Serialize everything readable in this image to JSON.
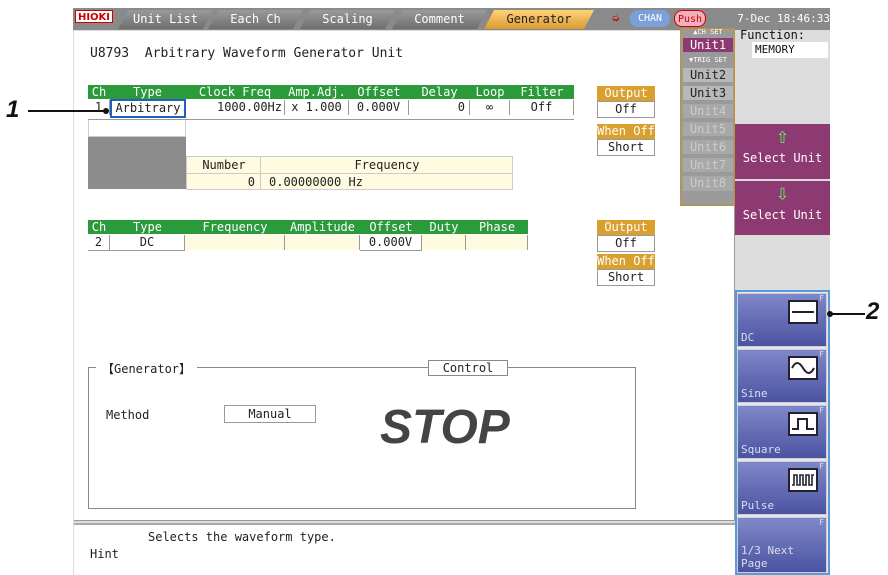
{
  "tabs": {
    "logo": "HIOKI",
    "items": [
      "Unit List",
      "Each Ch",
      "Scaling",
      "Comment",
      "Generator"
    ],
    "chan": "CHAN",
    "push": "Push",
    "datetime": "7-Dec 18:46:33"
  },
  "title": "U8793  Arbitrary Waveform Generator Unit",
  "ch1": {
    "headers": [
      "Ch",
      "Type",
      "Clock Freq",
      "Amp.Adj.",
      "Offset",
      "Delay",
      "Loop",
      "Filter"
    ],
    "ch": "1",
    "type": "Arbitrary",
    "clock": "1000.00Hz",
    "amp": "x 1.000",
    "offset": "0.000V",
    "delay": "0",
    "loop": "∞",
    "filter": "Off"
  },
  "ch1_output": {
    "h1": "Output",
    "v1": "Off",
    "h2": "When Off",
    "v2": "Short"
  },
  "ch1_sub": {
    "h_number": "Number",
    "h_freq": "Frequency",
    "number": "0",
    "freq": "0.00000000 Hz"
  },
  "ch2": {
    "headers": [
      "Ch",
      "Type",
      "Frequency",
      "Amplitude",
      "Offset",
      "Duty",
      "Phase"
    ],
    "ch": "2",
    "type": "DC",
    "offset": "0.000V"
  },
  "ch2_output": {
    "h1": "Output",
    "v1": "Off",
    "h2": "When Off",
    "v2": "Short"
  },
  "generator": {
    "title": "【Generator】",
    "control_label": "Control",
    "method_label": "Method",
    "method_value": "Manual",
    "state": "STOP"
  },
  "hint": {
    "label": "Hint",
    "text": "Selects the waveform type."
  },
  "right": {
    "chset": "▲CH SET",
    "trigset": "▼TRIG SET",
    "units": [
      "Unit1",
      "Unit2",
      "Unit3",
      "Unit4",
      "Unit5",
      "Unit6",
      "Unit7",
      "Unit8"
    ],
    "function_label": "Function:",
    "function_value": "MEMORY",
    "select_up": "Select Unit",
    "select_down": "Select Unit"
  },
  "fkeys": [
    {
      "label": "DC",
      "icon": "dc-wave-icon"
    },
    {
      "label": "Sine",
      "icon": "sine-wave-icon"
    },
    {
      "label": "Square",
      "icon": "square-wave-icon"
    },
    {
      "label": "Pulse",
      "icon": "pulse-wave-icon"
    },
    {
      "label": "1/3 Next Page",
      "icon": ""
    }
  ],
  "callouts": [
    "1",
    "2"
  ],
  "colors": {
    "green": "#2a9a3a",
    "orange": "#d9a030",
    "purple": "#8e3a72",
    "blue": "#4a54a0"
  }
}
